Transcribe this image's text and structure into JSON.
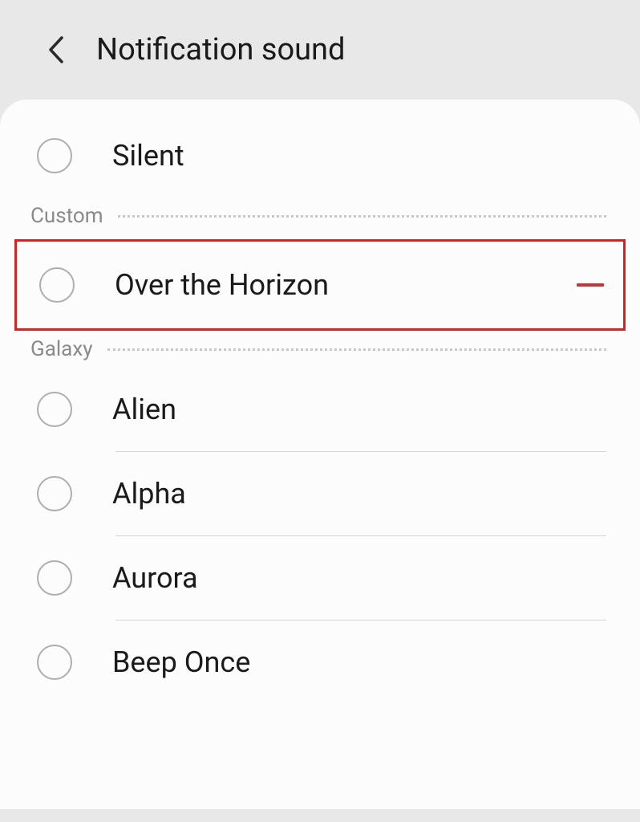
{
  "header": {
    "title": "Notification sound"
  },
  "sections": {
    "silent_label": "Silent",
    "custom": {
      "label": "Custom",
      "items": [
        {
          "label": "Over the Horizon"
        }
      ]
    },
    "galaxy": {
      "label": "Galaxy",
      "items": [
        {
          "label": "Alien"
        },
        {
          "label": "Alpha"
        },
        {
          "label": "Aurora"
        },
        {
          "label": "Beep Once"
        }
      ]
    }
  }
}
